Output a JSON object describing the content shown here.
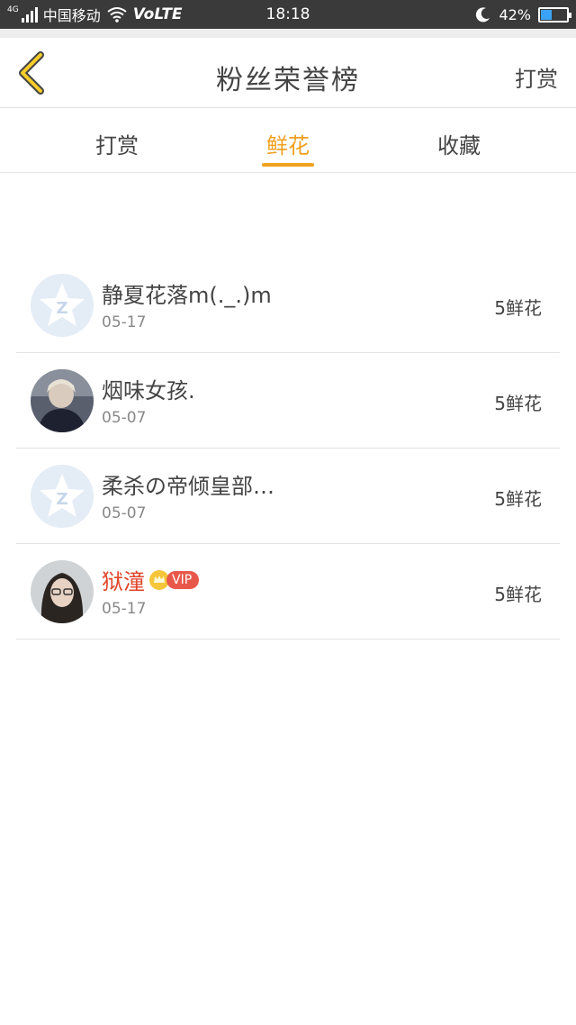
{
  "status_bar": {
    "network_tag": "4G",
    "carrier": "中国移动",
    "volte": "VoLTE",
    "time": "18:18",
    "battery_percent": "42%",
    "battery_level": 0.42,
    "battery_color": "#3aa3f5"
  },
  "header": {
    "back_icon": "chevron-left-icon",
    "title": "粉丝荣誉榜",
    "action_label": "打赏"
  },
  "tabs": [
    {
      "label": "打赏",
      "active": false
    },
    {
      "label": "鲜花",
      "active": true
    },
    {
      "label": "收藏",
      "active": false
    }
  ],
  "accent_color": "#f0a020",
  "list": [
    {
      "name": "静夏花落m(._.)m",
      "date": "05-17",
      "amount": "5鲜花",
      "avatar": "default-qq-avatar"
    },
    {
      "name": "烟味女孩.",
      "date": "05-07",
      "amount": "5鲜花",
      "avatar": "photo-avatar"
    },
    {
      "name": "柔杀の帝倾皇部…",
      "date": "05-07",
      "amount": "5鲜花",
      "avatar": "default-qq-avatar"
    },
    {
      "name": "狱潼",
      "date": "05-17",
      "amount": "5鲜花",
      "avatar": "photo-avatar",
      "badge": "VIP"
    }
  ]
}
